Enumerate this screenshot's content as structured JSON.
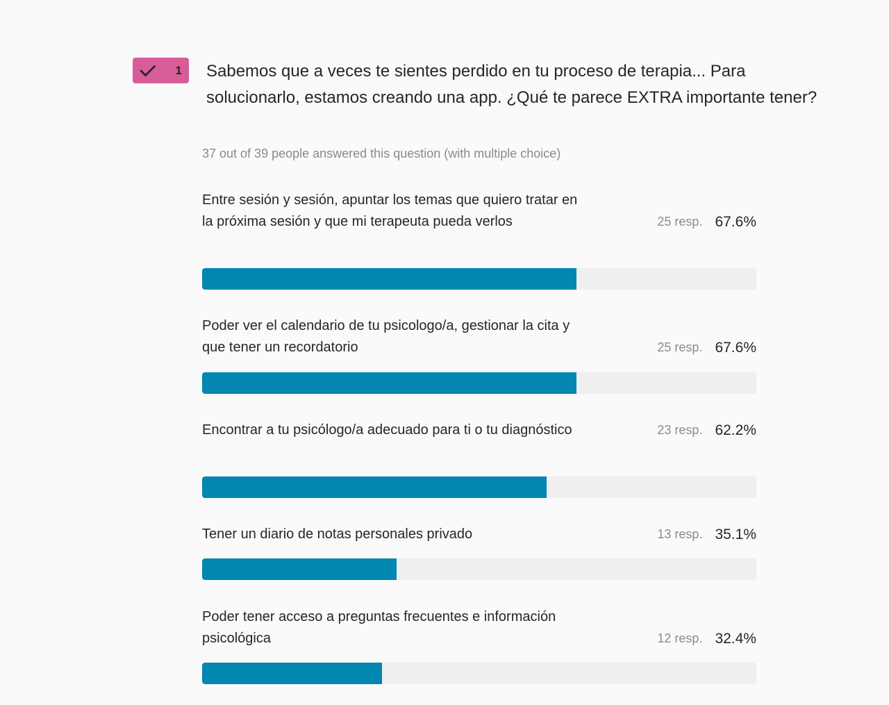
{
  "colors": {
    "badge": "#d85c98",
    "bar_fill": "#0287b0",
    "bar_track": "#efefef"
  },
  "question": {
    "number": "1",
    "badge_icon": "checkmark-icon",
    "title": "Sabemos que a veces te sientes perdido en tu proceso de terapia... Para solucionarlo, estamos creando una app. ¿Qué te parece EXTRA importante tener?",
    "answered_summary": "37 out of 39 people answered this question (with multiple choice)"
  },
  "options": [
    {
      "label": "Entre sesión y sesión, apuntar los temas que quiero tratar en la próxima sesión y que mi terapeuta pueda verlos",
      "responses": "25 resp.",
      "percent": "67.6%",
      "percent_value": 67.6
    },
    {
      "label": "Poder ver el calendario de tu psicologo/a, gestionar la cita y que tener un recordatorio",
      "responses": "25 resp.",
      "percent": "67.6%",
      "percent_value": 67.6
    },
    {
      "label": "Encontrar a tu psicólogo/a adecuado para ti o tu diagnóstico",
      "responses": "23 resp.",
      "percent": "62.2%",
      "percent_value": 62.2
    },
    {
      "label": "Tener un diario de notas personales privado",
      "responses": "13 resp.",
      "percent": "35.1%",
      "percent_value": 35.1
    },
    {
      "label": "Poder tener acceso a preguntas frecuentes e información psicológica",
      "responses": "12 resp.",
      "percent": "32.4%",
      "percent_value": 32.4
    }
  ]
}
